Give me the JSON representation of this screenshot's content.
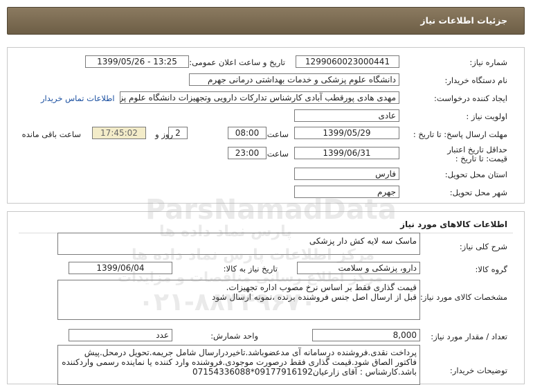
{
  "header": {
    "title": "جزئیات اطلاعات نیاز"
  },
  "need_info": {
    "need_number_label": "شماره نیاز:",
    "need_number": "1299060023000441",
    "announce_label": "تاریخ و ساعت اعلان عمومی:",
    "announce_value": "1399/05/26 - 13:25",
    "buyer_org_label": "نام دستگاه خریدار:",
    "buyer_org": "دانشگاه علوم پزشکی و خدمات بهداشتی درمانی جهرم",
    "requester_label": "ایجاد کننده درخواست:",
    "requester": "مهدی هادی پورقطب آبادی کارشناس تدارکات دارویی وتجهیزات دانشگاه علوم پزشکی جهرم",
    "contact_link": "اطلاعات تماس خریدار",
    "priority_label": "اولویت نیاز :",
    "priority": "عادی",
    "deadline_label": "مهلت ارسال پاسخ: تا تاریخ :",
    "deadline_date": "1399/05/29",
    "time_label": "ساعت",
    "deadline_time": "08:00",
    "days_count": "2",
    "days_label": "روز و",
    "remaining_time": "17:45:02",
    "remaining_label": "ساعت باقی مانده",
    "validity_label_1": "حداقل تاریخ اعتبار",
    "validity_label_2": "قیمت: تا تاریخ :",
    "validity_date": "1399/06/31",
    "validity_time": "23:00",
    "province_label": "استان محل تحویل:",
    "province": "فارس",
    "city_label": "شهر محل تحویل:",
    "city": "جهرم"
  },
  "goods": {
    "section_title": "اطلاعات کالاهای مورد نیاز",
    "summary_label": "شرح کلی نیاز:",
    "summary": "ماسک سه لایه کش دار پزشکی",
    "group_label": "گروه کالا:",
    "group": "دارو، پزشکی و سلامت",
    "need_date_label": "تاریخ نیاز به کالا:",
    "need_date": "1399/06/04",
    "specs_label": "مشخصات کالای مورد نیاز:",
    "specs": "قیمت گذاری فقط بر اساس نرخ مصوب اداره تجهیزات.\nقبل از ارسال اصل جنس فروشنده برنده ،نمونه ارسال شود",
    "qty_label": "تعداد / مقدار مورد نیاز:",
    "qty": "8,000",
    "unit_label": "واحد شمارش:",
    "unit": "عدد",
    "notes_label": "توضیحات خریدار:",
    "notes": "پرداخت نقدی.فروشنده درسامانه آی مدعضوباشد.تاخیردرارسال شامل جریمه.تحویل درمحل.پیش فاکتور الصاق شود.قیمت گذاری فقط درصورت موجودی.فروشنده وارد کننده یا نماینده رسمی واردکننده باشد.کارشناس : آقای زارعیان09177916192*07154336088"
  },
  "watermark": {
    "line1": "ParsNamadData",
    "line2": "پارس نماد داده ها",
    "line3": "مرکز اطلاعات پارس نماد داده ها",
    "line4": "مرکز اطلاع رسانی مناقصات و مزایدات",
    "line5": "۰۲۱-۸۸۳۴۹۶۷۰"
  }
}
